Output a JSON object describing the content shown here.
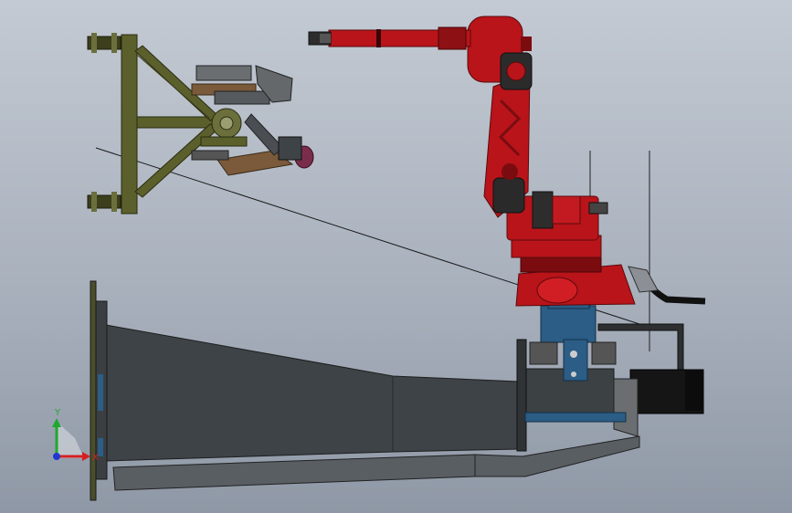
{
  "viewport": {
    "background_top": "#c3cad3",
    "background_bottom": "#8f98a6"
  },
  "colors": {
    "robot_red": "#b8141a",
    "robot_dark_red": "#7a0c10",
    "frame_olive": "#5b5f2c",
    "frame_dark": "#3c3f1c",
    "positioner_blue": "#2b5d86",
    "housing_gray": "#3e4347",
    "slab_gray": "#595e62",
    "wire_black": "#111111",
    "axis_x": "#d42020",
    "axis_y": "#20a830",
    "axis_z": "#2038d0"
  },
  "triad": {
    "y_label": "Y",
    "x_label": "X"
  }
}
